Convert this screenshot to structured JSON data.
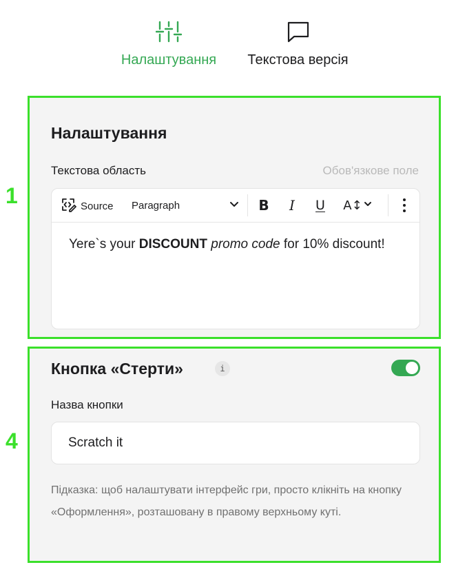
{
  "tabs": [
    {
      "label": "Налаштування",
      "icon": "sliders-icon",
      "active": true
    },
    {
      "label": "Текстова версія",
      "icon": "chat-bubble-icon",
      "active": false
    }
  ],
  "steps": {
    "first": "1",
    "second": "4"
  },
  "settings_section": {
    "title": "Налаштування",
    "field_label": "Текстова область",
    "required_hint": "Обов'язкове поле",
    "toolbar": {
      "source_label": "Source",
      "paragraph_label": "Paragraph",
      "bold": "B",
      "italic": "I",
      "underline": "U",
      "font_size": "A↕"
    },
    "content": {
      "part1": "Yere`s your ",
      "bold": "DISCOUNT",
      "space": " ",
      "italic": "promo code",
      "part2": " for 10% discount!"
    }
  },
  "erase_section": {
    "title": "Кнопка «Стерти»",
    "info_icon": "i",
    "toggle_on": true,
    "field_label": "Назва кнопки",
    "input_value": "Scratch it",
    "hint": "Підказка: щоб налаштувати інтерфейс гри, просто клікніть на кнопку «Оформлення», розташовану в правому верхньому куті."
  },
  "colors": {
    "accent": "#34a853",
    "highlight_border": "#3be02b",
    "section_bg": "#f4f4f4"
  }
}
